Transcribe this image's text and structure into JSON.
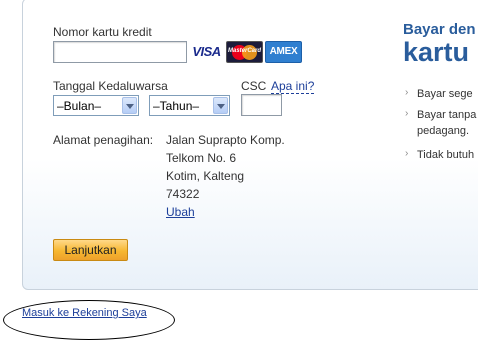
{
  "form": {
    "card_number_label": "Nomor kartu kredit",
    "card_number_value": "",
    "card_logos": {
      "visa": "VISA",
      "mastercard": "MasterCard",
      "amex": "AMEX"
    },
    "expiry_label": "Tanggal Kedaluwarsa",
    "month_select": "–Bulan–",
    "year_select": "–Tahun–",
    "csc_label": "CSC",
    "csc_help_link": "Apa ini?",
    "csc_value": "",
    "billing_label": "Alamat penagihan:",
    "billing_address": [
      "Jalan Suprapto Komp.",
      "Telkom No. 6",
      "Kotim, Kalteng",
      "74322"
    ],
    "change_link": "Ubah",
    "continue_button": "Lanjutkan"
  },
  "promo": {
    "title_line1": "Bayar den",
    "title_line2": "kartu",
    "bullets": [
      "Bayar sege",
      "Bayar tanpa",
      "pedagang.",
      "Tidak butuh"
    ]
  },
  "footer": {
    "login_link": "Masuk ke Rekening Saya"
  },
  "colors": {
    "link": "#1d3f9a",
    "title_blue": "#2a5d9c",
    "button_orange": "#f7b731"
  }
}
